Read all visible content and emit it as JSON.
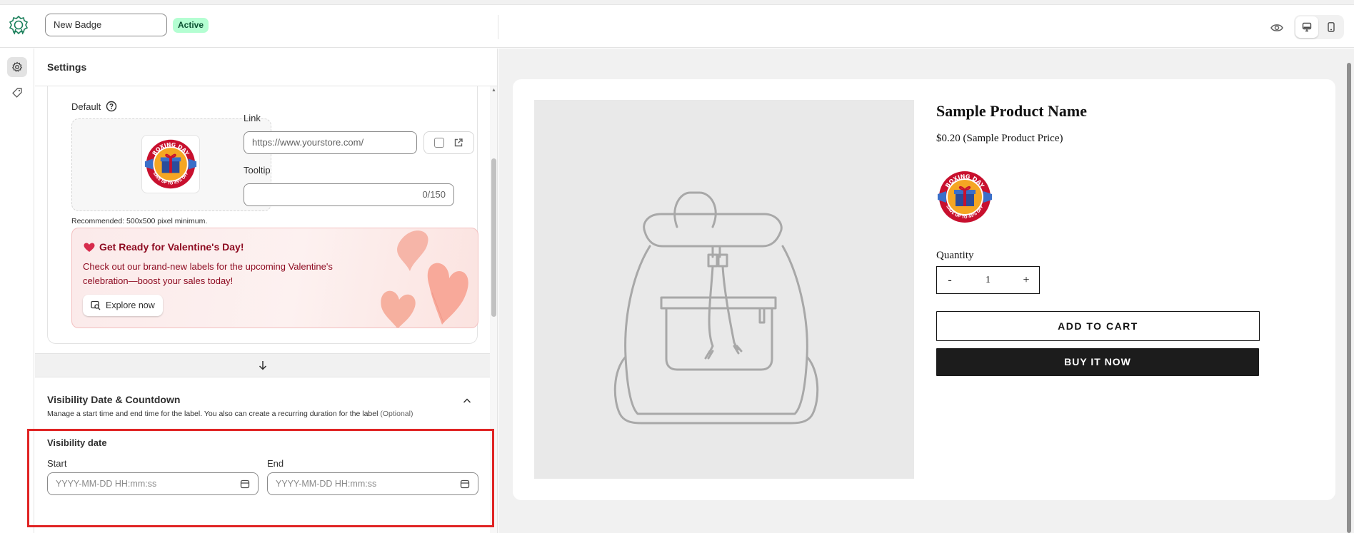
{
  "header": {
    "badge_name": "New Badge",
    "status": "Active"
  },
  "settings": {
    "title": "Settings",
    "default_label": "Default",
    "recommended_hint": "Recommended: 500x500 pixel minimum.",
    "link": {
      "label": "Link",
      "placeholder": "https://www.yourstore.com/"
    },
    "tooltip": {
      "label": "Tooltip",
      "counter": "0/150"
    },
    "promo": {
      "title": "Get Ready for Valentine's Day!",
      "text": "Check out our brand-new labels for the upcoming Valentine's celebration—boost your sales today!",
      "button": "Explore now"
    },
    "visibility": {
      "title": "Visibility Date & Countdown",
      "description": "Manage a start time and end time for the label. You also can create a recurring duration for the label",
      "optional": "(Optional)",
      "date_title": "Visibility date",
      "start_label": "Start",
      "end_label": "End",
      "date_placeholder": "YYYY-MM-DD HH:mm:ss"
    }
  },
  "preview": {
    "product_name": "Sample Product Name",
    "product_price": "$0.20 (Sample Product Price)",
    "quantity_label": "Quantity",
    "quantity_minus": "-",
    "quantity_value": "1",
    "quantity_plus": "+",
    "add_to_cart": "ADD TO CART",
    "buy_now": "BUY IT NOW"
  },
  "badge_art": {
    "line1": "BOXING DAY",
    "line2": "SAVE UP TO 45% OFF",
    "colors": {
      "ring": "#c8102e",
      "inner": "#f5a623",
      "box": "#2b4c9b",
      "ribbon": "#3a6fc9"
    }
  },
  "colors": {
    "accent_red": "#e02424",
    "active_badge_bg": "#b4fed2",
    "promo_text": "#8e0b21"
  },
  "icons": [
    "app-logo-icon",
    "eye-icon",
    "desktop-icon",
    "mobile-icon",
    "gear-icon",
    "tag-icon",
    "help-icon",
    "external-link-icon",
    "heart-icon",
    "explore-icon",
    "arrow-down-icon",
    "chevron-up-icon",
    "calendar-icon"
  ]
}
